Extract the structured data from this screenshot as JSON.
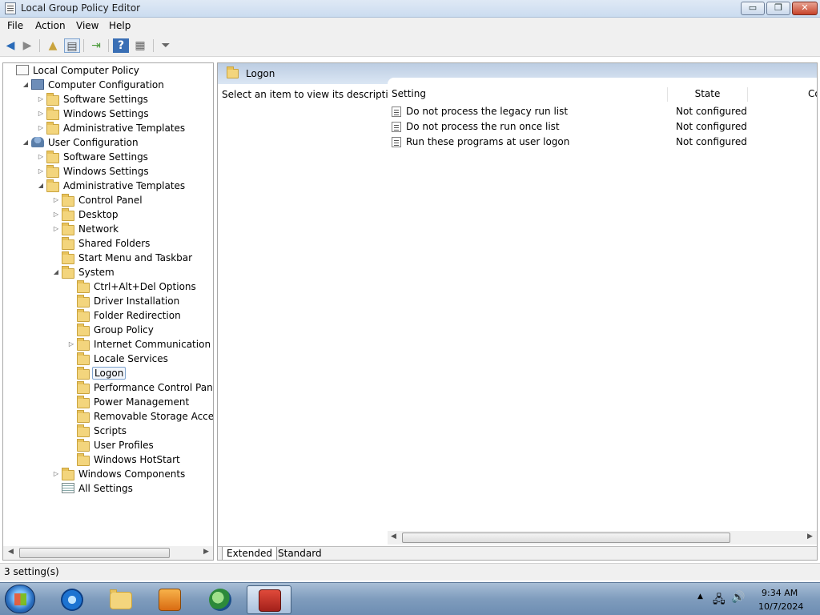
{
  "window": {
    "title": "Local Group Policy Editor",
    "controls": {
      "minimize": "▭",
      "maximize": "❐",
      "close": "✕"
    }
  },
  "menu": [
    "File",
    "Action",
    "View",
    "Help"
  ],
  "tree": {
    "nodes": [
      {
        "label": "Local Computer Policy",
        "icon": "policy-icon",
        "arrow": ""
      },
      {
        "label": "Computer Configuration",
        "icon": "computer-icon",
        "arrow": "◢"
      },
      {
        "label": "Software Settings",
        "icon": "folder-icon",
        "arrow": "▷"
      },
      {
        "label": "Windows Settings",
        "icon": "folder-icon",
        "arrow": "▷"
      },
      {
        "label": "Administrative Templates",
        "icon": "folder-icon",
        "arrow": "▷"
      },
      {
        "label": "User Configuration",
        "icon": "user-icon",
        "arrow": "◢"
      },
      {
        "label": "Software Settings",
        "icon": "folder-icon",
        "arrow": "▷"
      },
      {
        "label": "Windows Settings",
        "icon": "folder-icon",
        "arrow": "▷"
      },
      {
        "label": "Administrative Templates",
        "icon": "folder-icon",
        "arrow": "◢"
      },
      {
        "label": "Control Panel",
        "icon": "folder-icon",
        "arrow": "▷"
      },
      {
        "label": "Desktop",
        "icon": "folder-icon",
        "arrow": "▷"
      },
      {
        "label": "Network",
        "icon": "folder-icon",
        "arrow": "▷"
      },
      {
        "label": "Shared Folders",
        "icon": "folder-icon",
        "arrow": ""
      },
      {
        "label": "Start Menu and Taskbar",
        "icon": "folder-icon",
        "arrow": ""
      },
      {
        "label": "System",
        "icon": "folder-icon",
        "arrow": "◢"
      },
      {
        "label": "Ctrl+Alt+Del Options",
        "icon": "folder-icon",
        "arrow": ""
      },
      {
        "label": "Driver Installation",
        "icon": "folder-icon",
        "arrow": ""
      },
      {
        "label": "Folder Redirection",
        "icon": "folder-icon",
        "arrow": ""
      },
      {
        "label": "Group Policy",
        "icon": "folder-icon",
        "arrow": ""
      },
      {
        "label": "Internet Communication Man",
        "icon": "folder-icon",
        "arrow": "▷"
      },
      {
        "label": "Locale Services",
        "icon": "folder-icon",
        "arrow": ""
      },
      {
        "label": "Logon",
        "icon": "folder-icon",
        "arrow": "",
        "selected": true
      },
      {
        "label": "Performance Control Panel",
        "icon": "folder-icon",
        "arrow": ""
      },
      {
        "label": "Power Management",
        "icon": "folder-icon",
        "arrow": ""
      },
      {
        "label": "Removable Storage Access",
        "icon": "folder-icon",
        "arrow": ""
      },
      {
        "label": "Scripts",
        "icon": "folder-icon",
        "arrow": ""
      },
      {
        "label": "User Profiles",
        "icon": "folder-icon",
        "arrow": ""
      },
      {
        "label": "Windows HotStart",
        "icon": "folder-icon",
        "arrow": ""
      },
      {
        "label": "Windows Components",
        "icon": "folder-icon",
        "arrow": "▷"
      },
      {
        "label": "All Settings",
        "icon": "all-settings-icon",
        "arrow": ""
      }
    ]
  },
  "detail": {
    "header": "Logon",
    "description": "Select an item to view its description.",
    "columns": [
      "Setting",
      "State",
      "Co"
    ],
    "rows": [
      {
        "setting": "Do not process the legacy run list",
        "state": "Not configured"
      },
      {
        "setting": "Do not process the run once list",
        "state": "Not configured"
      },
      {
        "setting": "Run these programs at user logon",
        "state": "Not configured"
      }
    ],
    "tabs": [
      "Extended",
      "Standard"
    ]
  },
  "status": "3 setting(s)",
  "taskbar": {
    "apps": [
      "internet-explorer-icon",
      "windows-explorer-icon",
      "media-player-icon",
      "network-globe-icon",
      "group-policy-toolbox-icon"
    ],
    "time": "9:34 AM",
    "date": "10/7/2024"
  }
}
